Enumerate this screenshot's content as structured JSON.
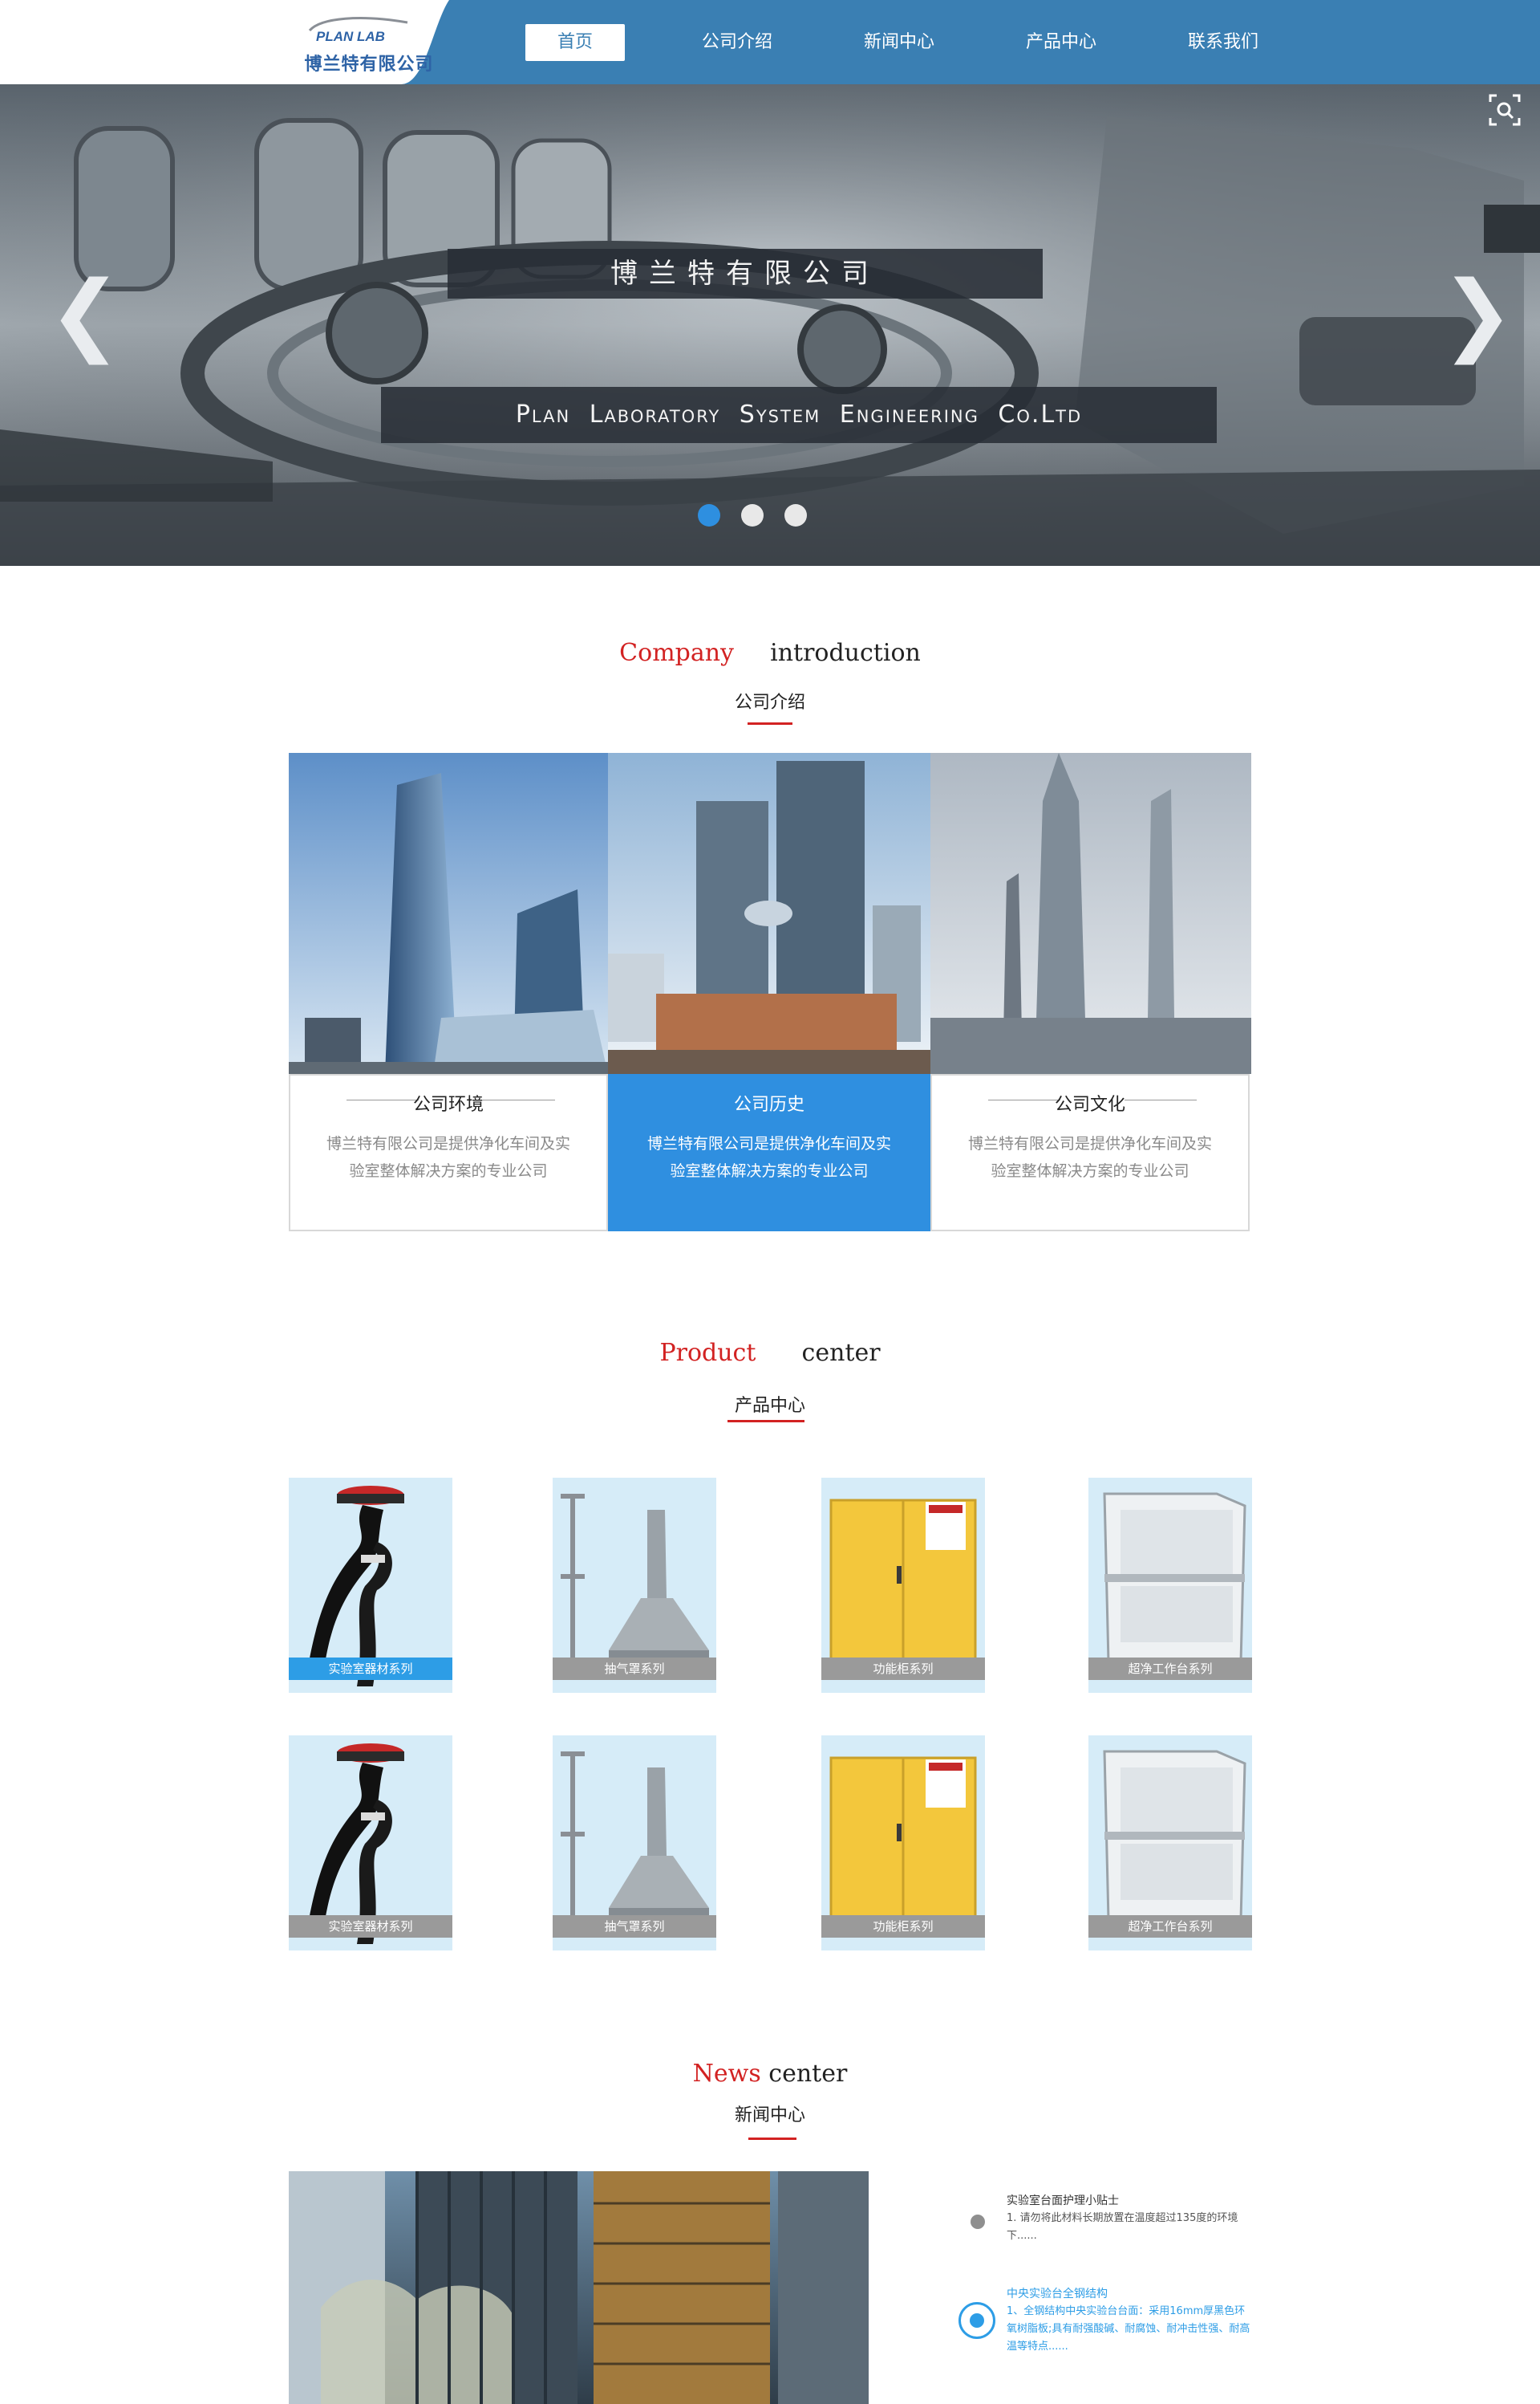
{
  "header": {
    "logo_mark": "PLAN LAB",
    "logo_company": "博兰特有限公司",
    "nav": [
      {
        "label": "首页",
        "active": true
      },
      {
        "label": "公司介绍"
      },
      {
        "label": "新闻中心"
      },
      {
        "label": "产品中心"
      },
      {
        "label": "联系我们"
      }
    ],
    "brand_color": "#3a7fb3"
  },
  "banner": {
    "title": "博兰特有限公司",
    "subtitle": "Plan Laboratory System Engineering Co.Ltd",
    "prev_icon": "chevron-left-icon",
    "next_icon": "chevron-right-icon",
    "slides_count": 3,
    "active_slide": 1,
    "accent": "#2e8fe0"
  },
  "company_intro": {
    "title_red": "Company",
    "title_rest": "introduction",
    "subtitle": "公司介绍",
    "cards": [
      {
        "heading": "公司环境",
        "text": "博兰特有限公司是提供净化车间及实验室整体解决方案的专业公司",
        "active": false
      },
      {
        "heading": "公司历史",
        "text": "博兰特有限公司是提供净化车间及实验室整体解决方案的专业公司",
        "active": true
      },
      {
        "heading": "公司文化",
        "text": "博兰特有限公司是提供净化车间及实验室整体解决方案的专业公司",
        "active": false
      }
    ]
  },
  "product_center": {
    "title_red": "Product",
    "title_rest": "center",
    "subtitle": "产品中心",
    "rows": [
      [
        {
          "label": "实验室器材系列",
          "icon": "eyewash-icon",
          "highlight": true
        },
        {
          "label": "抽气罩系列",
          "icon": "fume-hood-icon"
        },
        {
          "label": "功能柜系列",
          "icon": "safety-cabinet-icon"
        },
        {
          "label": "超净工作台系列",
          "icon": "clean-bench-icon"
        }
      ],
      [
        {
          "label": "实验室器材系列",
          "icon": "eyewash-icon"
        },
        {
          "label": "抽气罩系列",
          "icon": "fume-hood-icon"
        },
        {
          "label": "功能柜系列",
          "icon": "safety-cabinet-icon"
        },
        {
          "label": "超净工作台系列",
          "icon": "clean-bench-icon"
        }
      ]
    ]
  },
  "news_center": {
    "title_red": "News",
    "title_rest": "center",
    "subtitle": "新闻中心",
    "items": [
      {
        "title": "实验室台面护理小贴士",
        "desc": "1. 请勿将此材料长期放置在温度超过135度的环境下......",
        "active": false
      },
      {
        "title": "中央实验台全钢结构",
        "desc": "1、全钢结构中央实验台台面：采用16mm厚黑色环氧树脂板;具有耐强酸碱、耐腐蚀、耐冲击性强、耐高温等特点......",
        "active": true
      }
    ]
  }
}
